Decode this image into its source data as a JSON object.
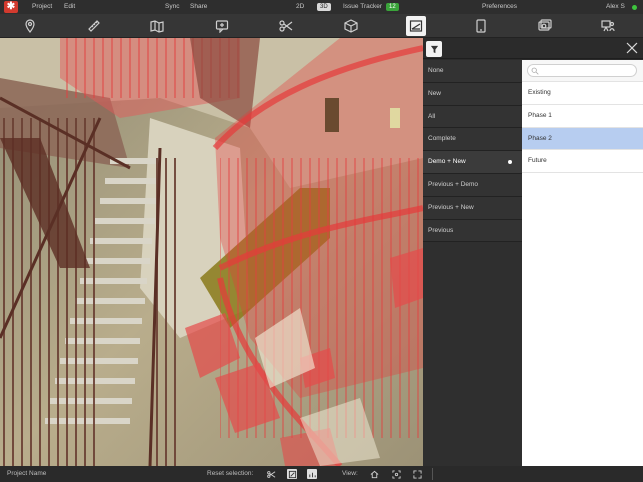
{
  "menubar": {
    "logo": "✱",
    "project": "Project",
    "edit": "Edit",
    "sync": "Sync",
    "share": "Share",
    "view_2d": "2D",
    "view_3d": "3D",
    "issue_tracker": "Issue Tracker",
    "issue_count": "12",
    "preferences": "Preferences",
    "user": "Alex S",
    "status_color": "#3ec43e"
  },
  "toolbar": {
    "tools": [
      "location-pin-icon",
      "ruler-icon",
      "map-icon",
      "add-comment-icon",
      "scissors-icon",
      "cube-icon",
      "phase-filter-icon",
      "tablet-icon",
      "camera-icon",
      "presentation-icon"
    ],
    "active_tool": "phase-filter-icon"
  },
  "phase_filter": {
    "items": [
      "None",
      "New",
      "All",
      "Complete",
      "Demo + New",
      "Previous + Demo",
      "Previous + New",
      "Previous"
    ],
    "selected": "Demo + New"
  },
  "phase_list": {
    "search_placeholder": "",
    "items": [
      "Existing",
      "Phase 1",
      "Phase 2",
      "Future"
    ],
    "selected": "Phase 2",
    "selected_color": "#b7cdf0"
  },
  "statusbar": {
    "project_name": "Project Name",
    "reset_selection": "Reset selection:",
    "view": "View:"
  }
}
